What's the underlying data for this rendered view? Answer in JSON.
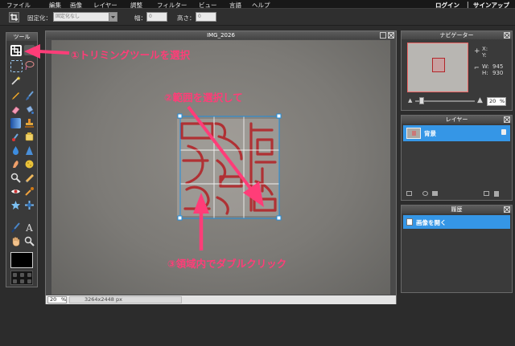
{
  "menu": {
    "items": [
      "ファイル",
      "編集",
      "画像",
      "レイヤー",
      "調整",
      "フィルター",
      "ビュー",
      "言語",
      "ヘルプ"
    ],
    "login": "ログイン",
    "separator": "|",
    "signup": "サインアップ"
  },
  "options": {
    "crop_mode_label": "固定化：",
    "crop_mode_value": "固定化なし",
    "width_label": "幅：",
    "width_value": "0",
    "height_label": "高さ：",
    "height_value": "0"
  },
  "tools_panel": {
    "title": "ツール"
  },
  "document": {
    "title": "IMG_2026",
    "zoom": "20",
    "zoom_unit": "%",
    "dimensions": "3264x2448 px"
  },
  "navigator": {
    "title": "ナビゲーター",
    "x_label": "X:",
    "y_label": "Y:",
    "w_label": "W:",
    "w_value": "945",
    "h_label": "H:",
    "h_value": "930",
    "zoom_value": "20",
    "zoom_unit": "%"
  },
  "layers": {
    "title": "レイヤー",
    "items": [
      {
        "name": "背景"
      }
    ]
  },
  "history": {
    "title": "履歴",
    "items": [
      {
        "label": "画像を開く"
      }
    ]
  },
  "annotations": {
    "step1": "①トリミングツールを選択",
    "step2": "②範囲を選択して",
    "step3": "③領域内でダブルクリック"
  },
  "colors": {
    "accent": "#ff3d78",
    "selection": "#1e8fe0",
    "stamp_red": "#b2262a",
    "panel_highlight": "#3596e6"
  },
  "icons": [
    "crop-icon",
    "marquee-icon",
    "lasso-icon",
    "wand-icon",
    "pencil-icon",
    "brush-icon",
    "eraser-icon",
    "bucket-icon",
    "gradient-icon",
    "stamp-icon",
    "sharpen-icon",
    "drop-icon",
    "dodge-icon",
    "burn-icon",
    "smudge-icon",
    "sponge-icon",
    "eye-icon",
    "color-replace-icon",
    "picker-icon",
    "text-icon",
    "hand-icon",
    "zoom-icon"
  ]
}
